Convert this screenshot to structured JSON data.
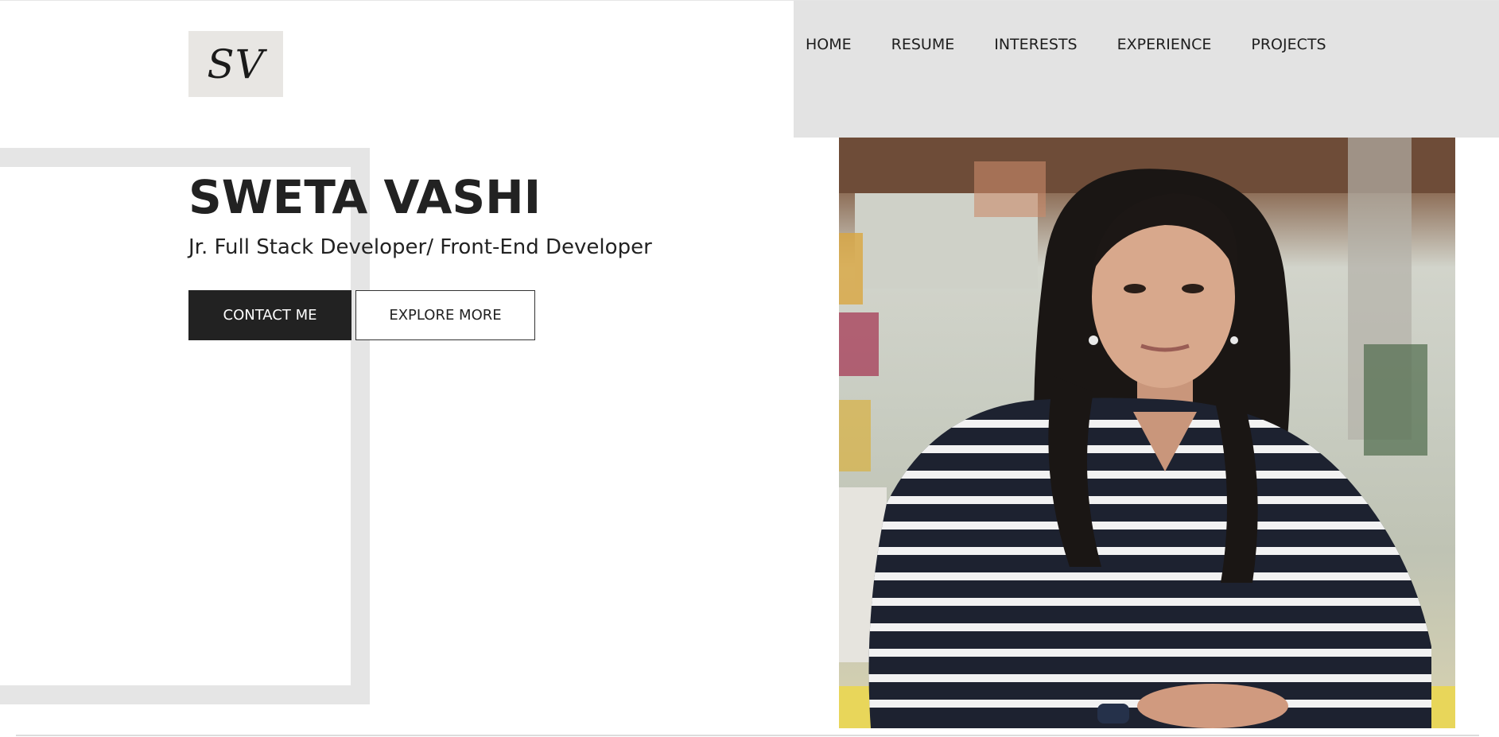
{
  "logo": {
    "text": "SV"
  },
  "nav": {
    "items": [
      {
        "label": "HOME"
      },
      {
        "label": "RESUME"
      },
      {
        "label": "INTERESTS"
      },
      {
        "label": "EXPERIENCE"
      },
      {
        "label": "PROJECTS"
      }
    ]
  },
  "hero": {
    "name": "SWETA VASHI",
    "subtitle": "Jr. Full Stack Developer/ Front-End Developer",
    "contact_label": "CONTACT ME",
    "explore_label": "EXPLORE MORE"
  },
  "colors": {
    "nav_background": "#e3e3e3",
    "primary_button": "#222222",
    "frame": "#e5e5e5"
  }
}
